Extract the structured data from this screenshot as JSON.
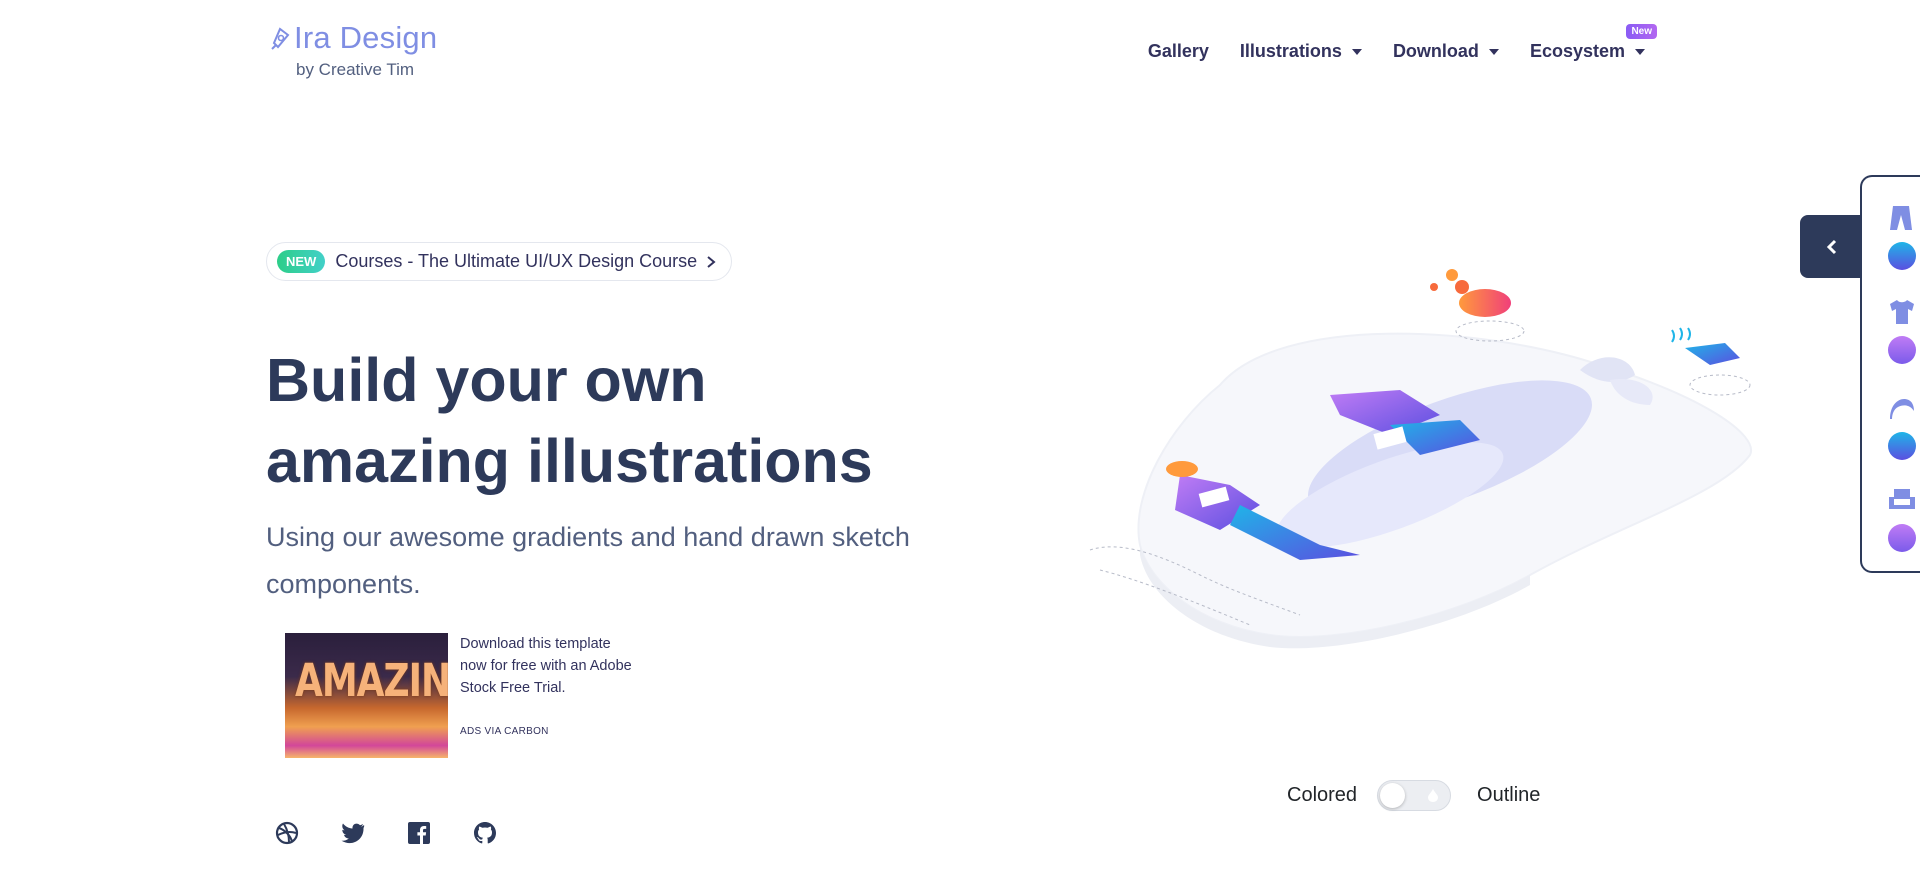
{
  "brand": {
    "name": "Ira Design",
    "subtitle": "by Creative Tim"
  },
  "nav": {
    "items": [
      {
        "label": "Gallery",
        "dropdown": false
      },
      {
        "label": "Illustrations",
        "dropdown": true
      },
      {
        "label": "Download",
        "dropdown": true
      },
      {
        "label": "Ecosystem",
        "dropdown": true,
        "badge": "New"
      }
    ]
  },
  "announcement": {
    "badge": "NEW",
    "text": "Courses - The Ultimate UI/UX Design Course"
  },
  "hero": {
    "title_line1": "Build your own",
    "title_line2": "amazing illustrations",
    "subtitle": "Using our awesome gradients and hand drawn sketch components."
  },
  "ad": {
    "image_text": "AMAZING",
    "text": "Download this template now for free with an Adobe Stock Free Trial.",
    "via": "ADS VIA CARBON"
  },
  "social": [
    "dribbble-icon",
    "twitter-icon",
    "facebook-icon",
    "github-icon"
  ],
  "toggle": {
    "left_label": "Colored",
    "right_label": "Outline",
    "state": "colored"
  },
  "side_panel": {
    "items": [
      {
        "icon": "pants-icon",
        "gradient": [
          "#1fb5e8",
          "#5b4fe0"
        ]
      },
      {
        "icon": "shirt-icon",
        "gradient": [
          "#c07cf5",
          "#7b5bea"
        ]
      },
      {
        "icon": "hair-icon",
        "gradient": [
          "#1fb5e8",
          "#5b4fe0"
        ]
      },
      {
        "icon": "chair-icon",
        "gradient": [
          "#c07cf5",
          "#7b5bea"
        ]
      }
    ]
  },
  "colors": {
    "brand": "#7f8ee3",
    "heading": "#2d3a5a",
    "panel": "#2d3a5a",
    "badge_new": "#2dce89",
    "badge_nav": "#8a5cf5"
  }
}
